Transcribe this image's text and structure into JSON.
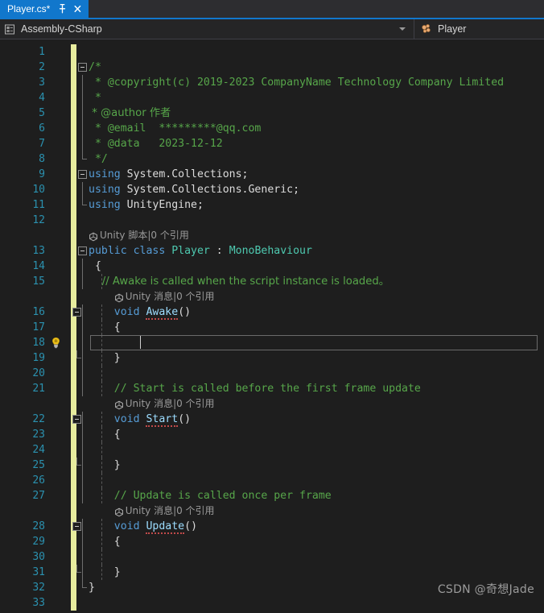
{
  "window": {
    "accent_color": "#1177CC",
    "background": "#1E1E1E",
    "tabstrip_background": "#2D2D30",
    "navbar_background": "#252526"
  },
  "tab": {
    "title": "Player.cs*",
    "pin_icon": "pin-icon",
    "close_icon": "close-icon"
  },
  "navbar": {
    "project_icon": "assembly-icon",
    "project": "Assembly-CSharp",
    "dropdown_icon": "chevron-down-icon",
    "type_icon": "class-icon",
    "type": "Player"
  },
  "editor": {
    "line_number_color": "#2B91AF",
    "change_bar_color": "#E7EC9E",
    "comment_color": "#57A64A",
    "keyword_color": "#569CD6",
    "type_color": "#4EC9B0",
    "plain_color": "#DCDCDC",
    "codelens_color": "#9A9A9A",
    "current_line": 18,
    "bulb_icon": "lightbulb-icon",
    "lines": [
      {
        "num": "1",
        "kind": "code",
        "indent": 0,
        "change": true,
        "tokens": []
      },
      {
        "num": "2",
        "kind": "code",
        "indent": 0,
        "change": true,
        "outline": "box",
        "tokens": [
          {
            "c": "c",
            "s": "/*"
          }
        ]
      },
      {
        "num": "3",
        "kind": "code",
        "indent": 0,
        "change": true,
        "outline": "line",
        "tokens": [
          {
            "c": "c",
            "s": " * @copyright(c) 2019-2023 CompanyName Technology Company Limited"
          }
        ]
      },
      {
        "num": "4",
        "kind": "code",
        "indent": 0,
        "change": true,
        "outline": "line",
        "tokens": [
          {
            "c": "c",
            "s": " *"
          }
        ]
      },
      {
        "num": "5",
        "kind": "code",
        "indent": 0,
        "change": true,
        "outline": "line",
        "tokens": [
          {
            "c": "c",
            "s": " * @author 作者"
          }
        ]
      },
      {
        "num": "6",
        "kind": "code",
        "indent": 0,
        "change": true,
        "outline": "line",
        "tokens": [
          {
            "c": "c",
            "s": " * @email  *********@qq.com"
          }
        ]
      },
      {
        "num": "7",
        "kind": "code",
        "indent": 0,
        "change": true,
        "outline": "line",
        "tokens": [
          {
            "c": "c",
            "s": " * @data   2023-12-12"
          }
        ]
      },
      {
        "num": "8",
        "kind": "code",
        "indent": 0,
        "change": true,
        "outline": "end",
        "tokens": [
          {
            "c": "c",
            "s": " */"
          }
        ]
      },
      {
        "num": "9",
        "kind": "code",
        "indent": 0,
        "change": true,
        "outline": "box",
        "tokens": [
          {
            "c": "k",
            "s": "using"
          },
          {
            "c": "pl",
            "s": " System.Collections;"
          }
        ]
      },
      {
        "num": "10",
        "kind": "code",
        "indent": 0,
        "change": true,
        "outline": "line",
        "tokens": [
          {
            "c": "k",
            "s": "using"
          },
          {
            "c": "pl",
            "s": " System.Collections.Generic;"
          }
        ]
      },
      {
        "num": "11",
        "kind": "code",
        "indent": 0,
        "change": true,
        "outline": "end",
        "tokens": [
          {
            "c": "k",
            "s": "using"
          },
          {
            "c": "pl",
            "s": " UnityEngine;"
          }
        ]
      },
      {
        "num": "12",
        "kind": "code",
        "indent": 0,
        "change": true,
        "tokens": []
      },
      {
        "num": "",
        "kind": "lens",
        "indent": 0,
        "change": true,
        "lens": "Unity 脚本|0 个引用"
      },
      {
        "num": "13",
        "kind": "code",
        "indent": 0,
        "change": true,
        "outline": "box",
        "tokens": [
          {
            "c": "k",
            "s": "public class "
          },
          {
            "c": "t",
            "s": "Player"
          },
          {
            "c": "pl",
            "s": " : "
          },
          {
            "c": "t",
            "s": "MonoBehaviour"
          }
        ]
      },
      {
        "num": "14",
        "kind": "code",
        "indent": 0,
        "change": true,
        "outline": "line",
        "tokens": [
          {
            "c": "br",
            "s": " {"
          }
        ]
      },
      {
        "num": "15",
        "kind": "code",
        "indent": 1,
        "change": true,
        "outline": "line",
        "tokens": [
          {
            "c": "c",
            "s": "    // Awake is called when the script instance is loaded。"
          }
        ]
      },
      {
        "num": "",
        "kind": "lens",
        "indent": 1,
        "change": true,
        "lens": "Unity 消息|0 个引用",
        "lens_indent": 4
      },
      {
        "num": "16",
        "kind": "code",
        "indent": 1,
        "change": true,
        "outline": "boxline",
        "tokens": [
          {
            "c": "pl",
            "s": "    "
          },
          {
            "c": "k",
            "s": "void"
          },
          {
            "c": "pl",
            "s": " "
          },
          {
            "c": "m sq",
            "s": "Awake"
          },
          {
            "c": "br",
            "s": "()"
          }
        ]
      },
      {
        "num": "17",
        "kind": "code",
        "indent": 1,
        "change": true,
        "outline": "line",
        "tokens": [
          {
            "c": "pl",
            "s": "    "
          },
          {
            "c": "br",
            "s": "{"
          }
        ]
      },
      {
        "num": "18",
        "kind": "current",
        "indent": 1,
        "change": true,
        "outline": "line",
        "bulb": true,
        "tokens": []
      },
      {
        "num": "19",
        "kind": "code",
        "indent": 1,
        "change": true,
        "outline": "endline",
        "tokens": [
          {
            "c": "pl",
            "s": "    "
          },
          {
            "c": "br",
            "s": "}"
          }
        ]
      },
      {
        "num": "20",
        "kind": "code",
        "indent": 1,
        "change": true,
        "outline": "line",
        "tokens": []
      },
      {
        "num": "21",
        "kind": "code",
        "indent": 1,
        "change": true,
        "outline": "line",
        "tokens": [
          {
            "c": "c",
            "s": "    // Start is called before the first frame update"
          }
        ]
      },
      {
        "num": "",
        "kind": "lens",
        "indent": 1,
        "change": true,
        "lens": "Unity 消息|0 个引用",
        "lens_indent": 4
      },
      {
        "num": "22",
        "kind": "code",
        "indent": 1,
        "change": true,
        "outline": "boxline",
        "tokens": [
          {
            "c": "pl",
            "s": "    "
          },
          {
            "c": "k",
            "s": "void"
          },
          {
            "c": "pl",
            "s": " "
          },
          {
            "c": "m sq",
            "s": "Start"
          },
          {
            "c": "br",
            "s": "()"
          }
        ]
      },
      {
        "num": "23",
        "kind": "code",
        "indent": 1,
        "change": true,
        "outline": "line",
        "tokens": [
          {
            "c": "pl",
            "s": "    "
          },
          {
            "c": "br",
            "s": "{"
          }
        ]
      },
      {
        "num": "24",
        "kind": "code",
        "indent": 1,
        "change": true,
        "outline": "line",
        "tokens": []
      },
      {
        "num": "25",
        "kind": "code",
        "indent": 1,
        "change": true,
        "outline": "endline",
        "tokens": [
          {
            "c": "pl",
            "s": "    "
          },
          {
            "c": "br",
            "s": "}"
          }
        ]
      },
      {
        "num": "26",
        "kind": "code",
        "indent": 1,
        "change": true,
        "outline": "line",
        "tokens": []
      },
      {
        "num": "27",
        "kind": "code",
        "indent": 1,
        "change": true,
        "outline": "line",
        "tokens": [
          {
            "c": "c",
            "s": "    // Update is called once per frame"
          }
        ]
      },
      {
        "num": "",
        "kind": "lens",
        "indent": 1,
        "change": true,
        "lens": "Unity 消息|0 个引用",
        "lens_indent": 4
      },
      {
        "num": "28",
        "kind": "code",
        "indent": 1,
        "change": true,
        "outline": "boxline",
        "tokens": [
          {
            "c": "pl",
            "s": "    "
          },
          {
            "c": "k",
            "s": "void"
          },
          {
            "c": "pl",
            "s": " "
          },
          {
            "c": "m sq",
            "s": "Update"
          },
          {
            "c": "br",
            "s": "()"
          }
        ]
      },
      {
        "num": "29",
        "kind": "code",
        "indent": 1,
        "change": true,
        "outline": "line",
        "tokens": [
          {
            "c": "pl",
            "s": "    "
          },
          {
            "c": "br",
            "s": "{"
          }
        ]
      },
      {
        "num": "30",
        "kind": "code",
        "indent": 1,
        "change": true,
        "outline": "line",
        "tokens": []
      },
      {
        "num": "31",
        "kind": "code",
        "indent": 1,
        "change": true,
        "outline": "endline",
        "tokens": [
          {
            "c": "pl",
            "s": "    "
          },
          {
            "c": "br",
            "s": "}"
          }
        ]
      },
      {
        "num": "32",
        "kind": "code",
        "indent": 0,
        "change": true,
        "outline": "end",
        "tokens": [
          {
            "c": "br",
            "s": "}"
          }
        ]
      },
      {
        "num": "33",
        "kind": "code",
        "indent": 0,
        "change": true,
        "tokens": []
      }
    ]
  },
  "watermark": {
    "text": "CSDN @奇想Jade"
  }
}
